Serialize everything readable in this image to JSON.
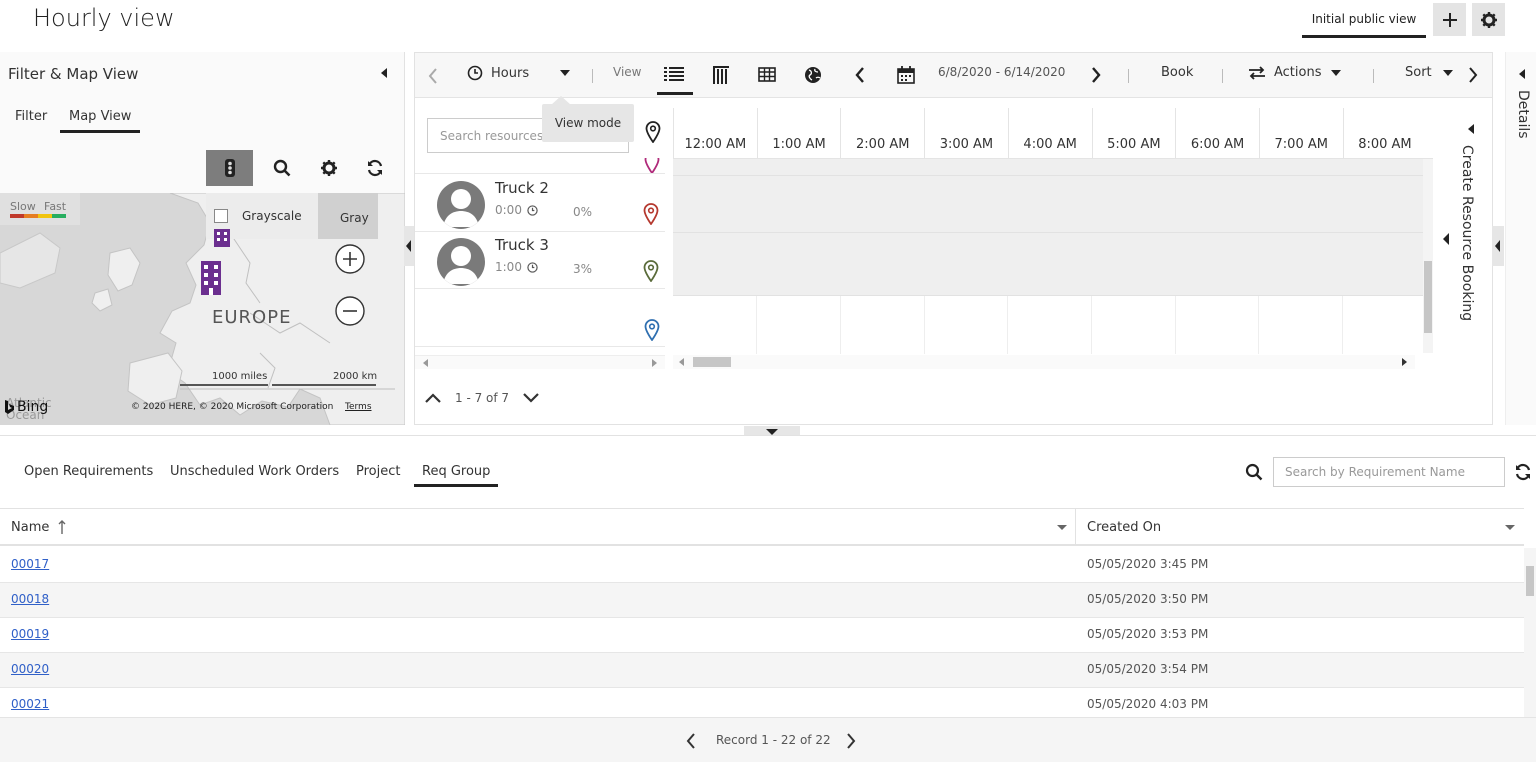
{
  "header": {
    "title": "Hourly view",
    "view_selector": "Initial public view",
    "add_icon": "plus-icon",
    "settings_icon": "gear-icon"
  },
  "left_panel": {
    "title": "Filter & Map View",
    "tabs": [
      "Filter",
      "Map View"
    ],
    "active_tab": "Map View",
    "map_tools": [
      "traffic-icon",
      "search-icon",
      "gear-icon",
      "refresh-icon"
    ],
    "map": {
      "legend_slow": "Slow",
      "legend_fast": "Fast",
      "grayscale_label": "Grayscale",
      "gray_button": "Gray",
      "region_label": "EUROPE",
      "scale_miles": "1000 miles",
      "scale_km": "2000 km",
      "brand": "Bing",
      "copyright": "© 2020 HERE, © 2020 Microsoft Corporation",
      "terms": "Terms",
      "ocean_label": "Atlantic\nOcean"
    }
  },
  "toolbar": {
    "time_scale": "Hours",
    "view_label": "View",
    "date_range": "6/8/2020 - 6/14/2020",
    "book_label": "Book",
    "actions_label": "Actions",
    "sort_label": "Sort",
    "tooltip": "View mode"
  },
  "resources": {
    "search_placeholder": "Search resources...",
    "rows": [
      {
        "name": "Truck 2",
        "hours": "0:00",
        "pct": "0%",
        "pin_color": "#b5382e"
      },
      {
        "name": "Truck 3",
        "hours": "1:00",
        "pct": "3%",
        "pin_color": "#5a6b3a"
      }
    ],
    "top_pin_color": "#b02a7a",
    "bottom_pin_color": "#2f6fb0",
    "pager": "1 - 7 of 7"
  },
  "timeline": {
    "hours": [
      "12:00 AM",
      "1:00 AM",
      "2:00 AM",
      "3:00 AM",
      "4:00 AM",
      "5:00 AM",
      "6:00 AM",
      "7:00 AM",
      "8:00 AM"
    ]
  },
  "side_panels": {
    "create_booking": "Create Resource Booking",
    "details": "Details"
  },
  "requirements": {
    "tabs": [
      "Open Requirements",
      "Unscheduled Work Orders",
      "Project",
      "Req Group"
    ],
    "active_tab": "Req Group",
    "search_placeholder": "Search by Requirement Name",
    "columns": [
      "Name",
      "Created On"
    ],
    "rows": [
      {
        "name": "00017",
        "created": "05/05/2020 3:45 PM"
      },
      {
        "name": "00018",
        "created": "05/05/2020 3:50 PM"
      },
      {
        "name": "00019",
        "created": "05/05/2020 3:53 PM"
      },
      {
        "name": "00020",
        "created": "05/05/2020 3:54 PM"
      },
      {
        "name": "00021",
        "created": "05/05/2020 4:03 PM"
      }
    ],
    "footer": "Record 1 - 22 of 22"
  }
}
